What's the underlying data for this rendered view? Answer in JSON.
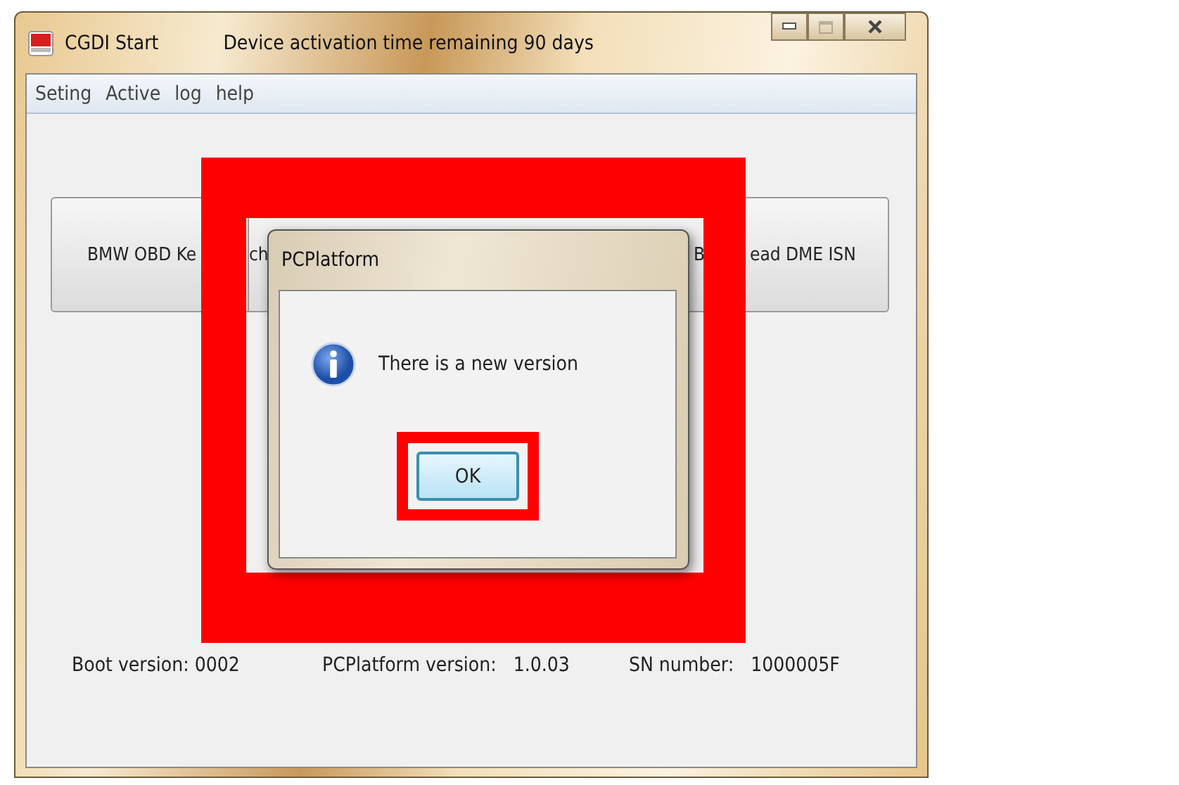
{
  "window": {
    "title": "CGDI Start",
    "subtitle": "Device activation time remaining 90 days",
    "controls": [
      {
        "kind": "minimize",
        "disabled": false
      },
      {
        "kind": "maximize",
        "disabled": true
      },
      {
        "kind": "close",
        "disabled": false
      }
    ]
  },
  "menu": [
    "Seting",
    "Active",
    "log",
    "help"
  ],
  "function_buttons": [
    {
      "label": "BMW OBD Ke"
    },
    {
      "label": "ch"
    },
    {
      "label": "B"
    },
    {
      "label": "ead DME ISN"
    }
  ],
  "status": [
    {
      "label": "Boot version: 0002"
    },
    {
      "label": "PCPlatform version:",
      "value": "1.0.03"
    },
    {
      "label": "SN number:",
      "value": "1000005F"
    }
  ],
  "dialog": {
    "title": "PCPlatform",
    "message": "There is a new version",
    "button": "OK"
  },
  "highlight_frame": {
    "color": "#ff0000"
  },
  "highlight_box": {
    "color": "#ff0000"
  }
}
